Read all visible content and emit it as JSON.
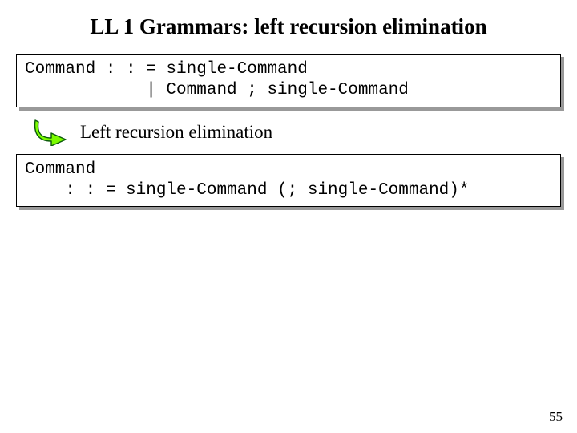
{
  "title": "LL 1 Grammars: left recursion elimination",
  "box1": {
    "line1": "Command : : = single-Command",
    "line2": "            | Command ; single-Command"
  },
  "transition_label": "Left recursion elimination",
  "box2": {
    "line1": "Command",
    "line2": "    : : = single-Command (; single-Command)*"
  },
  "page_number": "55",
  "icons": {
    "arrow": "curved-arrow-icon"
  }
}
